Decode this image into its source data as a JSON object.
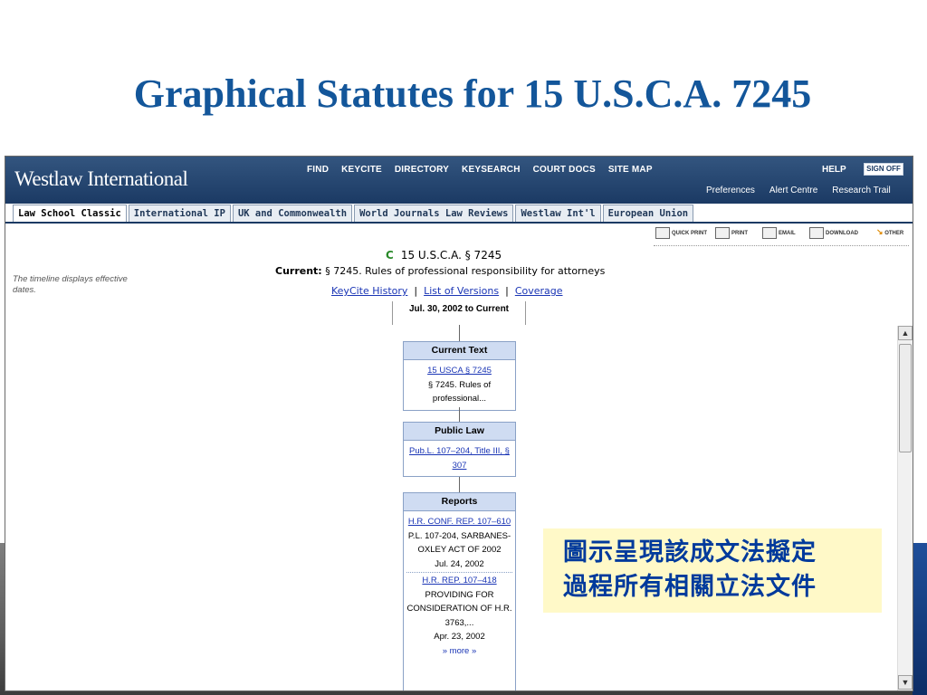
{
  "slide_title": "Graphical Statutes for 15 U.S.C.A. 7245",
  "logo": "Westlaw International",
  "topnav": [
    "FIND",
    "KEYCITE",
    "DIRECTORY",
    "KEYSEARCH",
    "COURT DOCS",
    "SITE MAP"
  ],
  "help": "HELP",
  "signoff": "SIGN OFF",
  "subnav": [
    "Preferences",
    "Alert Centre",
    "Research Trail"
  ],
  "tabs": [
    "Law School Classic",
    "International IP",
    "UK and Commonwealth",
    "World Journals Law Reviews",
    "Westlaw Int'l",
    "European Union"
  ],
  "toolbar": [
    "QUICK PRINT",
    "PRINT",
    "EMAIL",
    "DOWNLOAD",
    "OTHER"
  ],
  "document": {
    "flag": "C",
    "citation": "15 U.S.C.A. § 7245",
    "current_label": "Current:",
    "current_text": "§ 7245. Rules of professional responsibility for attorneys",
    "links": [
      "KeyCite History",
      "List of Versions",
      "Coverage"
    ]
  },
  "sidenote": "The timeline displays effective dates.",
  "timeline": {
    "date": "Jul. 30, 2002 to Current",
    "current_text": {
      "title": "Current Text",
      "link": "15 USCA § 7245",
      "text": "§ 7245. Rules of professional..."
    },
    "public_law": {
      "title": "Public Law",
      "link": "Pub.L. 107–204, Title III, § 307"
    },
    "reports": {
      "title": "Reports",
      "r1_link": "H.R. CONF. REP. 107–610",
      "r1_text": "P.L. 107-204, SARBANES-OXLEY ACT OF 2002",
      "r1_date": "Jul. 24, 2002",
      "r2_link": "H.R. REP. 107–418",
      "r2_text": "PROVIDING FOR CONSIDERATION OF H.R. 3763,...",
      "r2_date": "Apr. 23, 2002",
      "more": "more"
    }
  },
  "annotation": [
    "圖示呈現該成文法擬定",
    "過程所有相關立法文件"
  ]
}
